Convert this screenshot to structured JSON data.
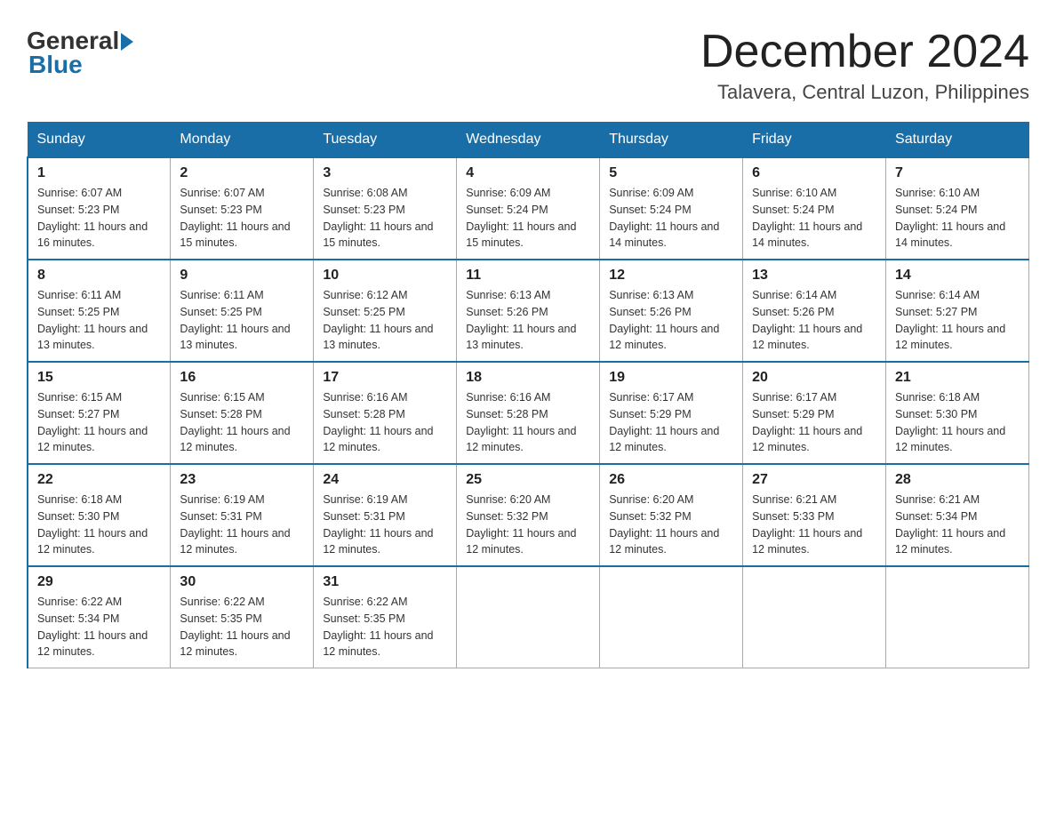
{
  "header": {
    "logo_general": "General",
    "logo_blue": "Blue",
    "month_title": "December 2024",
    "location": "Talavera, Central Luzon, Philippines"
  },
  "days_of_week": [
    "Sunday",
    "Monday",
    "Tuesday",
    "Wednesday",
    "Thursday",
    "Friday",
    "Saturday"
  ],
  "weeks": [
    [
      {
        "day": "1",
        "sunrise": "6:07 AM",
        "sunset": "5:23 PM",
        "daylight": "11 hours and 16 minutes."
      },
      {
        "day": "2",
        "sunrise": "6:07 AM",
        "sunset": "5:23 PM",
        "daylight": "11 hours and 15 minutes."
      },
      {
        "day": "3",
        "sunrise": "6:08 AM",
        "sunset": "5:23 PM",
        "daylight": "11 hours and 15 minutes."
      },
      {
        "day": "4",
        "sunrise": "6:09 AM",
        "sunset": "5:24 PM",
        "daylight": "11 hours and 15 minutes."
      },
      {
        "day": "5",
        "sunrise": "6:09 AM",
        "sunset": "5:24 PM",
        "daylight": "11 hours and 14 minutes."
      },
      {
        "day": "6",
        "sunrise": "6:10 AM",
        "sunset": "5:24 PM",
        "daylight": "11 hours and 14 minutes."
      },
      {
        "day": "7",
        "sunrise": "6:10 AM",
        "sunset": "5:24 PM",
        "daylight": "11 hours and 14 minutes."
      }
    ],
    [
      {
        "day": "8",
        "sunrise": "6:11 AM",
        "sunset": "5:25 PM",
        "daylight": "11 hours and 13 minutes."
      },
      {
        "day": "9",
        "sunrise": "6:11 AM",
        "sunset": "5:25 PM",
        "daylight": "11 hours and 13 minutes."
      },
      {
        "day": "10",
        "sunrise": "6:12 AM",
        "sunset": "5:25 PM",
        "daylight": "11 hours and 13 minutes."
      },
      {
        "day": "11",
        "sunrise": "6:13 AM",
        "sunset": "5:26 PM",
        "daylight": "11 hours and 13 minutes."
      },
      {
        "day": "12",
        "sunrise": "6:13 AM",
        "sunset": "5:26 PM",
        "daylight": "11 hours and 12 minutes."
      },
      {
        "day": "13",
        "sunrise": "6:14 AM",
        "sunset": "5:26 PM",
        "daylight": "11 hours and 12 minutes."
      },
      {
        "day": "14",
        "sunrise": "6:14 AM",
        "sunset": "5:27 PM",
        "daylight": "11 hours and 12 minutes."
      }
    ],
    [
      {
        "day": "15",
        "sunrise": "6:15 AM",
        "sunset": "5:27 PM",
        "daylight": "11 hours and 12 minutes."
      },
      {
        "day": "16",
        "sunrise": "6:15 AM",
        "sunset": "5:28 PM",
        "daylight": "11 hours and 12 minutes."
      },
      {
        "day": "17",
        "sunrise": "6:16 AM",
        "sunset": "5:28 PM",
        "daylight": "11 hours and 12 minutes."
      },
      {
        "day": "18",
        "sunrise": "6:16 AM",
        "sunset": "5:28 PM",
        "daylight": "11 hours and 12 minutes."
      },
      {
        "day": "19",
        "sunrise": "6:17 AM",
        "sunset": "5:29 PM",
        "daylight": "11 hours and 12 minutes."
      },
      {
        "day": "20",
        "sunrise": "6:17 AM",
        "sunset": "5:29 PM",
        "daylight": "11 hours and 12 minutes."
      },
      {
        "day": "21",
        "sunrise": "6:18 AM",
        "sunset": "5:30 PM",
        "daylight": "11 hours and 12 minutes."
      }
    ],
    [
      {
        "day": "22",
        "sunrise": "6:18 AM",
        "sunset": "5:30 PM",
        "daylight": "11 hours and 12 minutes."
      },
      {
        "day": "23",
        "sunrise": "6:19 AM",
        "sunset": "5:31 PM",
        "daylight": "11 hours and 12 minutes."
      },
      {
        "day": "24",
        "sunrise": "6:19 AM",
        "sunset": "5:31 PM",
        "daylight": "11 hours and 12 minutes."
      },
      {
        "day": "25",
        "sunrise": "6:20 AM",
        "sunset": "5:32 PM",
        "daylight": "11 hours and 12 minutes."
      },
      {
        "day": "26",
        "sunrise": "6:20 AM",
        "sunset": "5:32 PM",
        "daylight": "11 hours and 12 minutes."
      },
      {
        "day": "27",
        "sunrise": "6:21 AM",
        "sunset": "5:33 PM",
        "daylight": "11 hours and 12 minutes."
      },
      {
        "day": "28",
        "sunrise": "6:21 AM",
        "sunset": "5:34 PM",
        "daylight": "11 hours and 12 minutes."
      }
    ],
    [
      {
        "day": "29",
        "sunrise": "6:22 AM",
        "sunset": "5:34 PM",
        "daylight": "11 hours and 12 minutes."
      },
      {
        "day": "30",
        "sunrise": "6:22 AM",
        "sunset": "5:35 PM",
        "daylight": "11 hours and 12 minutes."
      },
      {
        "day": "31",
        "sunrise": "6:22 AM",
        "sunset": "5:35 PM",
        "daylight": "11 hours and 12 minutes."
      },
      null,
      null,
      null,
      null
    ]
  ]
}
